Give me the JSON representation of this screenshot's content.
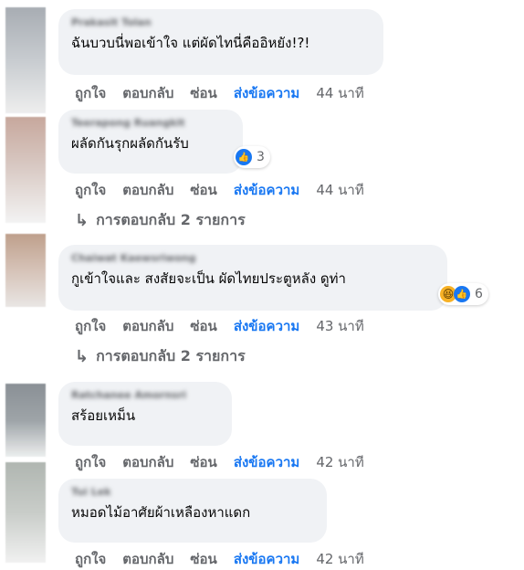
{
  "comments": [
    {
      "author": "Prakasit Tolan",
      "text": "ฉันบวบนี่พอเข้าใจ แต่ผัดไทนี่คืออิหยัง!?!",
      "actions": {
        "like": "ถูกใจ",
        "reply": "ตอบกลับ",
        "hide": "ซ่อน",
        "send": "ส่งข้อความ",
        "time": "44 นาที"
      },
      "avatar_color": "#9aa0a6"
    },
    {
      "author": "Teerapong Ruangkit",
      "text": "ผลัดกันรุกผลัดกันรับ",
      "reaction_count": "3",
      "actions": {
        "like": "ถูกใจ",
        "reply": "ตอบกลับ",
        "hide": "ซ่อน",
        "send": "ส่งข้อความ",
        "time": "44 นาที"
      },
      "replies": "การตอบกลับ 2 รายการ",
      "avatar_color": "#c9a89e"
    },
    {
      "author": "Chaiwat Kaewsriwong",
      "text": "กูเข้าใจและ สงสัยจะเป็น ผัดไทยประตูหลัง ดูท่า",
      "reaction_count": "6",
      "actions": {
        "like": "ถูกใจ",
        "reply": "ตอบกลับ",
        "hide": "ซ่อน",
        "send": "ส่งข้อความ",
        "time": "43 นาที"
      },
      "replies": "การตอบกลับ 2 รายการ",
      "avatar_color": "#bfa38f"
    },
    {
      "author": "Ratchanee Amornsri",
      "text": "สร้อยเหม็น",
      "actions": {
        "like": "ถูกใจ",
        "reply": "ตอบกลับ",
        "hide": "ซ่อน",
        "send": "ส่งข้อความ",
        "time": "42 นาที"
      },
      "avatar_color": "#8e9499"
    },
    {
      "author": "Tui Lek",
      "text": "หมอดไม้อาศัยผ้าเหลืองหาแดก",
      "actions": {
        "like": "ถูกใจ",
        "reply": "ตอบกลับ",
        "hide": "ซ่อน",
        "send": "ส่งข้อความ",
        "time": "42 นาที"
      },
      "avatar_color": "#b5bab5"
    }
  ],
  "colors": {
    "link": "#1877f2",
    "meta": "#65676b",
    "bubble": "#f0f2f5"
  },
  "icons": {
    "reply_arrow": "reply-arrow-icon",
    "like": "like-icon",
    "haha": "haha-icon"
  }
}
